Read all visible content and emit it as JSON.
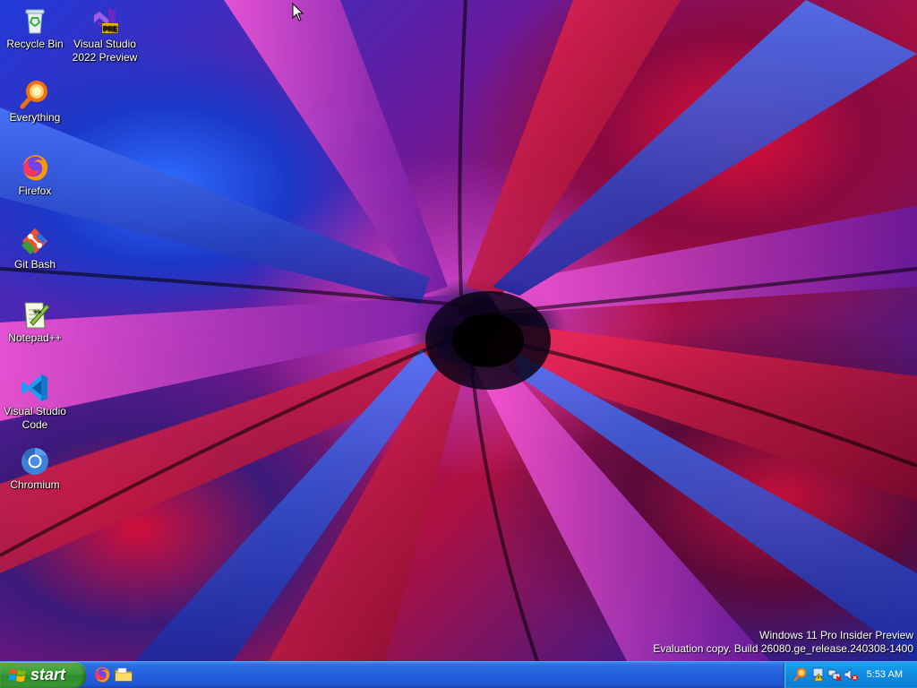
{
  "desktop": {
    "icons": [
      {
        "label": "Recycle Bin",
        "icon": "recycle-bin-icon"
      },
      {
        "label": "Visual Studio 2022 Preview",
        "icon": "visual-studio-preview-icon",
        "badge": "PRE"
      },
      {
        "label": "Everything",
        "icon": "everything-search-icon"
      },
      {
        "label": "Firefox",
        "icon": "firefox-icon"
      },
      {
        "label": "Git Bash",
        "icon": "git-bash-icon"
      },
      {
        "label": "Notepad++",
        "icon": "notepad-plus-plus-icon"
      },
      {
        "label": "Visual Studio Code",
        "icon": "vscode-icon"
      },
      {
        "label": "Chromium",
        "icon": "chromium-icon"
      }
    ],
    "watermark": {
      "line1": "Windows 11 Pro Insider Preview",
      "line2": "Evaluation copy. Build 26080.ge_release.240308-1400"
    }
  },
  "taskbar": {
    "start_label": "start",
    "quick_launch": [
      {
        "name": "Firefox",
        "icon": "firefox-icon"
      },
      {
        "name": "File Explorer",
        "icon": "folder-icon"
      }
    ],
    "tray": {
      "icons": [
        "search-icon",
        "warning-icon",
        "network-disconnected-icon",
        "volume-muted-icon"
      ],
      "clock": "5:53 AM"
    }
  },
  "colors": {
    "taskbar_blue": "#245edc",
    "start_green": "#3c9b38",
    "tray_blue": "#0f8ae0"
  }
}
